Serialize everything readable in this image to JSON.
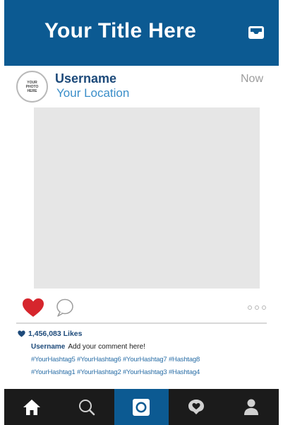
{
  "header": {
    "title": "Your Title Here",
    "inbox_icon": "inbox-icon"
  },
  "post": {
    "avatar_text": "YOUR\nPHOTO\nHERE",
    "username": "Username",
    "location": "Your Location",
    "timestamp": "Now",
    "likes": "1,456,083 Likes",
    "comment_user": "Username",
    "comment_text": "Add your comment here!",
    "hashtags_line1": "#YourHashtag5 #YourHashtag6 #YourHashtag7 #Hashtag8",
    "hashtags_line2": "#YourHashtag1 #YourHashtag2 #YourHashtag3 #Hashtag4"
  },
  "actions": {
    "like_icon": "heart-icon",
    "comment_icon": "comment-icon",
    "more_icon": "more-dots-icon"
  },
  "nav": {
    "items": [
      "home-icon",
      "search-icon",
      "camera-icon",
      "activity-icon",
      "profile-icon"
    ],
    "active_index": 2
  },
  "colors": {
    "brand": "#0c5a92",
    "nav_bg": "#1b1b1b",
    "heart": "#d6262d",
    "username": "#1d4a7a",
    "link": "#3a8ec9"
  }
}
